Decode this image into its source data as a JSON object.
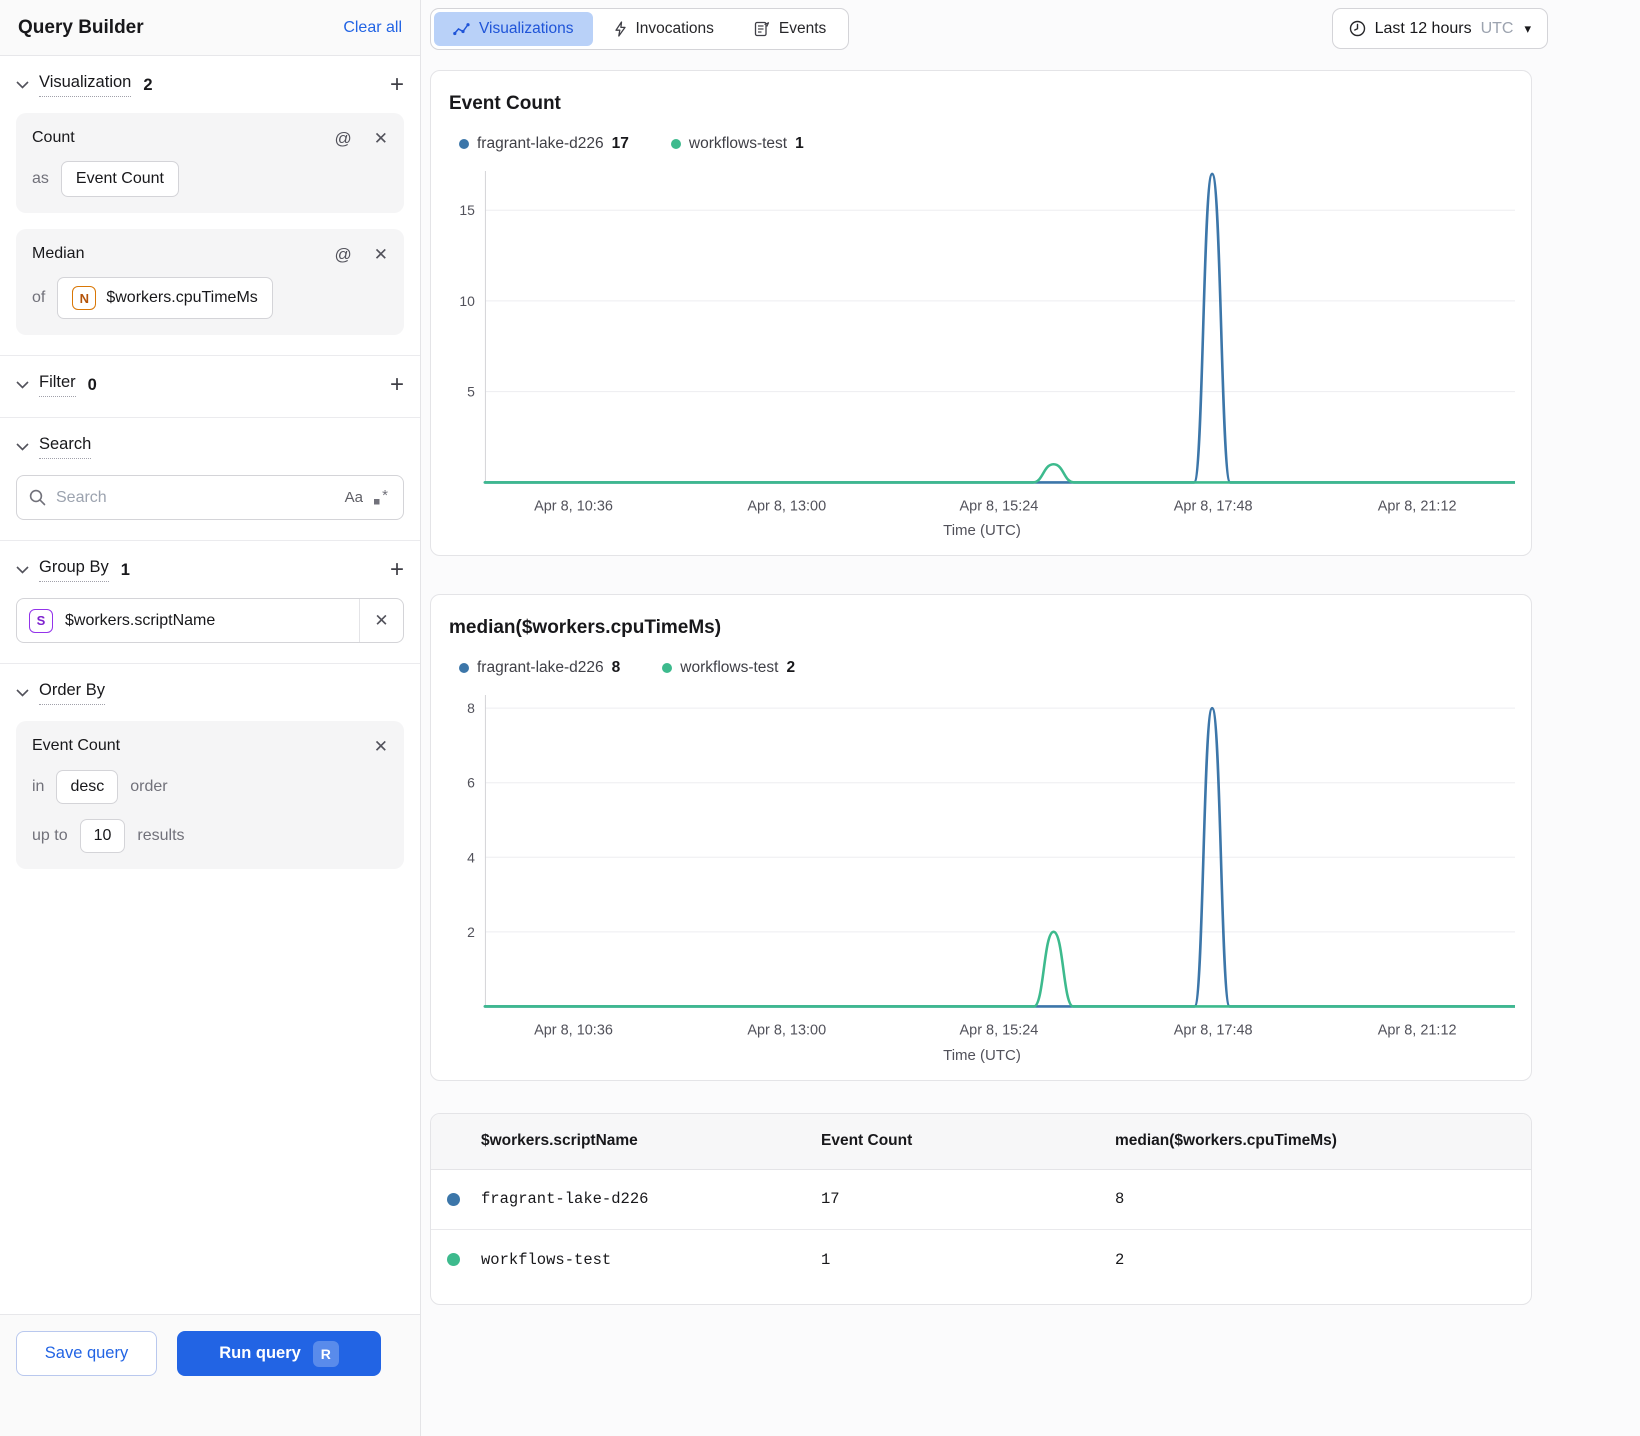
{
  "glyphs": {
    "plus": "+",
    "at": "@",
    "close": "✕",
    "caret": "▾",
    "match_case": "Aa"
  },
  "colors": {
    "accent_blue": "#2264e4",
    "series_blue": "#3c76a9",
    "series_green": "#3dba8d",
    "tab_active_bg": "#b9d1f8",
    "tab_active_text": "#1f54d8"
  },
  "sidebar": {
    "title": "Query Builder",
    "clear_all": "Clear all",
    "visualization": {
      "label": "Visualization",
      "count": "2"
    },
    "count_card": {
      "title": "Count",
      "as_label": "as",
      "value": "Event Count"
    },
    "median_card": {
      "title": "Median",
      "of_label": "of",
      "badge": "N",
      "value": "$workers.cpuTimeMs"
    },
    "filter": {
      "label": "Filter",
      "count": "0"
    },
    "search": {
      "label": "Search",
      "placeholder": "Search"
    },
    "group_by": {
      "label": "Group By",
      "count": "1",
      "badge": "S",
      "value": "$workers.scriptName"
    },
    "order_by": {
      "label": "Order By",
      "field": "Event Count",
      "in_label": "in",
      "direction": "desc",
      "order_label": "order",
      "upto_label": "up to",
      "limit": "10",
      "results_label": "results"
    },
    "save_button": "Save query",
    "run_button": "Run query",
    "run_shortcut": "R"
  },
  "tabs": [
    {
      "label": "Visualizations",
      "active": true
    },
    {
      "label": "Invocations",
      "active": false
    },
    {
      "label": "Events",
      "active": false
    }
  ],
  "time_range": {
    "label": "Last 12 hours",
    "timezone": "UTC"
  },
  "chart_data": [
    {
      "type": "line",
      "title": "Event Count",
      "xlabel": "Time (UTC)",
      "ylim": [
        0,
        17.05
      ],
      "y_ticks": [
        5,
        10,
        15
      ],
      "x_ticks": [
        {
          "label": "Apr 8, 10:36",
          "t": 0.086
        },
        {
          "label": "Apr 8, 13:00",
          "t": 0.293
        },
        {
          "label": "Apr 8, 15:24",
          "t": 0.499
        },
        {
          "label": "Apr 8, 17:48",
          "t": 0.707
        },
        {
          "label": "Apr 8, 21:12",
          "t": 0.905
        }
      ],
      "legend": [
        {
          "name": "fragrant-lake-d226",
          "value": "17",
          "color": "#3c76a9"
        },
        {
          "name": "workflows-test",
          "value": "1",
          "color": "#3dba8d"
        }
      ],
      "series": [
        {
          "name": "fragrant-lake-d226",
          "color": "#3c76a9",
          "baseline": 0,
          "peaks": [
            {
              "t": 0.706,
              "halfwidth": 0.0175,
              "value": 17
            }
          ]
        },
        {
          "name": "workflows-test",
          "color": "#3dba8d",
          "baseline": 0,
          "peaks": [
            {
              "t": 0.552,
              "halfwidth": 0.02,
              "value": 1
            }
          ]
        }
      ]
    },
    {
      "type": "line",
      "title": "median($workers.cpuTimeMs)",
      "xlabel": "Time (UTC)",
      "ylim": [
        0,
        8.3
      ],
      "y_ticks": [
        2,
        4,
        6,
        8
      ],
      "x_ticks": [
        {
          "label": "Apr 8, 10:36",
          "t": 0.086
        },
        {
          "label": "Apr 8, 13:00",
          "t": 0.293
        },
        {
          "label": "Apr 8, 15:24",
          "t": 0.499
        },
        {
          "label": "Apr 8, 17:48",
          "t": 0.707
        },
        {
          "label": "Apr 8, 21:12",
          "t": 0.905
        }
      ],
      "legend": [
        {
          "name": "fragrant-lake-d226",
          "value": "8",
          "color": "#3c76a9"
        },
        {
          "name": "workflows-test",
          "value": "2",
          "color": "#3dba8d"
        }
      ],
      "series": [
        {
          "name": "fragrant-lake-d226",
          "color": "#3c76a9",
          "baseline": 0,
          "peaks": [
            {
              "t": 0.706,
              "halfwidth": 0.017,
              "value": 8
            }
          ]
        },
        {
          "name": "workflows-test",
          "color": "#3dba8d",
          "baseline": 0,
          "peaks": [
            {
              "t": 0.552,
              "halfwidth": 0.019,
              "value": 2
            }
          ]
        }
      ]
    }
  ],
  "table": {
    "columns": [
      "$workers.scriptName",
      "Event Count",
      "median($workers.cpuTimeMs)"
    ],
    "rows": [
      {
        "name": "fragrant-lake-d226",
        "event_count": "17",
        "median": "8",
        "color": "#3c76a9"
      },
      {
        "name": "workflows-test",
        "event_count": "1",
        "median": "2",
        "color": "#3dba8d"
      }
    ]
  }
}
